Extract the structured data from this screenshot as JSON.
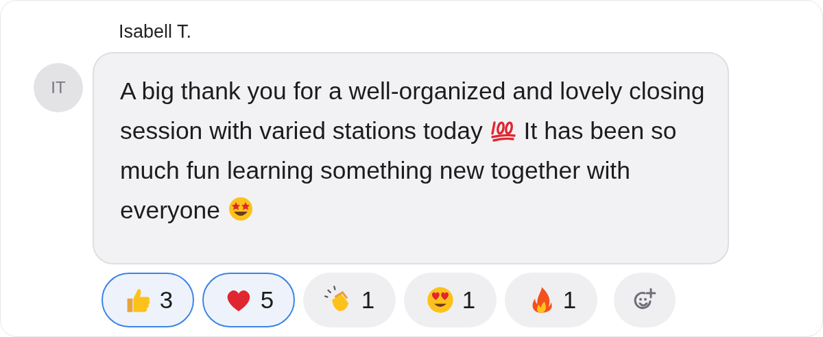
{
  "sender": {
    "name": "Isabell T.",
    "initials": "IT"
  },
  "message": [
    {
      "kind": "text",
      "text": "A big thank you for a well-organized and lovely closing session with varied stations today "
    },
    {
      "kind": "hundred"
    },
    {
      "kind": "text",
      "text": " It has been so much fun learning something new together with everyone "
    },
    {
      "kind": "starstruck"
    }
  ],
  "reactions": [
    {
      "kind": "thumbs",
      "count": "3",
      "selected": true
    },
    {
      "kind": "heart",
      "count": "5",
      "selected": true
    },
    {
      "kind": "clap",
      "count": "1",
      "selected": false
    },
    {
      "kind": "hearteyes",
      "count": "1",
      "selected": false
    },
    {
      "kind": "fire",
      "count": "1",
      "selected": false
    }
  ],
  "add_reaction": {
    "kind": "add"
  }
}
